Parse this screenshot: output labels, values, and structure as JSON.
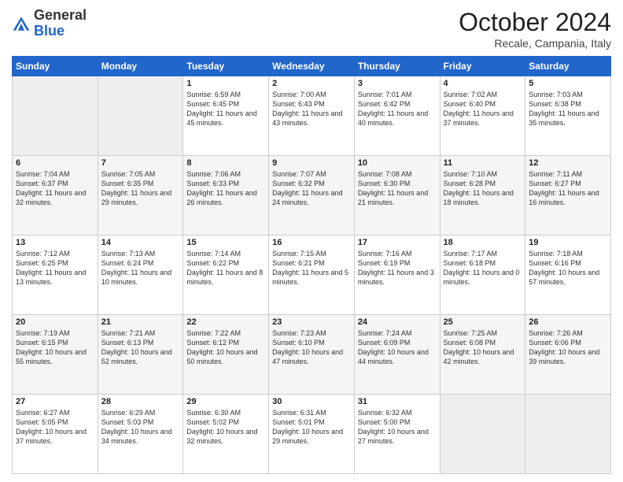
{
  "header": {
    "logo_general": "General",
    "logo_blue": "Blue",
    "month_title": "October 2024",
    "location": "Recale, Campania, Italy"
  },
  "days_of_week": [
    "Sunday",
    "Monday",
    "Tuesday",
    "Wednesday",
    "Thursday",
    "Friday",
    "Saturday"
  ],
  "weeks": [
    [
      {
        "day": "",
        "sunrise": "",
        "sunset": "",
        "daylight": ""
      },
      {
        "day": "",
        "sunrise": "",
        "sunset": "",
        "daylight": ""
      },
      {
        "day": "1",
        "sunrise": "Sunrise: 6:59 AM",
        "sunset": "Sunset: 6:45 PM",
        "daylight": "Daylight: 11 hours and 45 minutes."
      },
      {
        "day": "2",
        "sunrise": "Sunrise: 7:00 AM",
        "sunset": "Sunset: 6:43 PM",
        "daylight": "Daylight: 11 hours and 43 minutes."
      },
      {
        "day": "3",
        "sunrise": "Sunrise: 7:01 AM",
        "sunset": "Sunset: 6:42 PM",
        "daylight": "Daylight: 11 hours and 40 minutes."
      },
      {
        "day": "4",
        "sunrise": "Sunrise: 7:02 AM",
        "sunset": "Sunset: 6:40 PM",
        "daylight": "Daylight: 11 hours and 37 minutes."
      },
      {
        "day": "5",
        "sunrise": "Sunrise: 7:03 AM",
        "sunset": "Sunset: 6:38 PM",
        "daylight": "Daylight: 11 hours and 35 minutes."
      }
    ],
    [
      {
        "day": "6",
        "sunrise": "Sunrise: 7:04 AM",
        "sunset": "Sunset: 6:37 PM",
        "daylight": "Daylight: 11 hours and 32 minutes."
      },
      {
        "day": "7",
        "sunrise": "Sunrise: 7:05 AM",
        "sunset": "Sunset: 6:35 PM",
        "daylight": "Daylight: 11 hours and 29 minutes."
      },
      {
        "day": "8",
        "sunrise": "Sunrise: 7:06 AM",
        "sunset": "Sunset: 6:33 PM",
        "daylight": "Daylight: 11 hours and 26 minutes."
      },
      {
        "day": "9",
        "sunrise": "Sunrise: 7:07 AM",
        "sunset": "Sunset: 6:32 PM",
        "daylight": "Daylight: 11 hours and 24 minutes."
      },
      {
        "day": "10",
        "sunrise": "Sunrise: 7:08 AM",
        "sunset": "Sunset: 6:30 PM",
        "daylight": "Daylight: 11 hours and 21 minutes."
      },
      {
        "day": "11",
        "sunrise": "Sunrise: 7:10 AM",
        "sunset": "Sunset: 6:28 PM",
        "daylight": "Daylight: 11 hours and 18 minutes."
      },
      {
        "day": "12",
        "sunrise": "Sunrise: 7:11 AM",
        "sunset": "Sunset: 6:27 PM",
        "daylight": "Daylight: 11 hours and 16 minutes."
      }
    ],
    [
      {
        "day": "13",
        "sunrise": "Sunrise: 7:12 AM",
        "sunset": "Sunset: 6:25 PM",
        "daylight": "Daylight: 11 hours and 13 minutes."
      },
      {
        "day": "14",
        "sunrise": "Sunrise: 7:13 AM",
        "sunset": "Sunset: 6:24 PM",
        "daylight": "Daylight: 11 hours and 10 minutes."
      },
      {
        "day": "15",
        "sunrise": "Sunrise: 7:14 AM",
        "sunset": "Sunset: 6:22 PM",
        "daylight": "Daylight: 11 hours and 8 minutes."
      },
      {
        "day": "16",
        "sunrise": "Sunrise: 7:15 AM",
        "sunset": "Sunset: 6:21 PM",
        "daylight": "Daylight: 11 hours and 5 minutes."
      },
      {
        "day": "17",
        "sunrise": "Sunrise: 7:16 AM",
        "sunset": "Sunset: 6:19 PM",
        "daylight": "Daylight: 11 hours and 3 minutes."
      },
      {
        "day": "18",
        "sunrise": "Sunrise: 7:17 AM",
        "sunset": "Sunset: 6:18 PM",
        "daylight": "Daylight: 11 hours and 0 minutes."
      },
      {
        "day": "19",
        "sunrise": "Sunrise: 7:18 AM",
        "sunset": "Sunset: 6:16 PM",
        "daylight": "Daylight: 10 hours and 57 minutes."
      }
    ],
    [
      {
        "day": "20",
        "sunrise": "Sunrise: 7:19 AM",
        "sunset": "Sunset: 6:15 PM",
        "daylight": "Daylight: 10 hours and 55 minutes."
      },
      {
        "day": "21",
        "sunrise": "Sunrise: 7:21 AM",
        "sunset": "Sunset: 6:13 PM",
        "daylight": "Daylight: 10 hours and 52 minutes."
      },
      {
        "day": "22",
        "sunrise": "Sunrise: 7:22 AM",
        "sunset": "Sunset: 6:12 PM",
        "daylight": "Daylight: 10 hours and 50 minutes."
      },
      {
        "day": "23",
        "sunrise": "Sunrise: 7:23 AM",
        "sunset": "Sunset: 6:10 PM",
        "daylight": "Daylight: 10 hours and 47 minutes."
      },
      {
        "day": "24",
        "sunrise": "Sunrise: 7:24 AM",
        "sunset": "Sunset: 6:09 PM",
        "daylight": "Daylight: 10 hours and 44 minutes."
      },
      {
        "day": "25",
        "sunrise": "Sunrise: 7:25 AM",
        "sunset": "Sunset: 6:08 PM",
        "daylight": "Daylight: 10 hours and 42 minutes."
      },
      {
        "day": "26",
        "sunrise": "Sunrise: 7:26 AM",
        "sunset": "Sunset: 6:06 PM",
        "daylight": "Daylight: 10 hours and 39 minutes."
      }
    ],
    [
      {
        "day": "27",
        "sunrise": "Sunrise: 6:27 AM",
        "sunset": "Sunset: 5:05 PM",
        "daylight": "Daylight: 10 hours and 37 minutes."
      },
      {
        "day": "28",
        "sunrise": "Sunrise: 6:29 AM",
        "sunset": "Sunset: 5:03 PM",
        "daylight": "Daylight: 10 hours and 34 minutes."
      },
      {
        "day": "29",
        "sunrise": "Sunrise: 6:30 AM",
        "sunset": "Sunset: 5:02 PM",
        "daylight": "Daylight: 10 hours and 32 minutes."
      },
      {
        "day": "30",
        "sunrise": "Sunrise: 6:31 AM",
        "sunset": "Sunset: 5:01 PM",
        "daylight": "Daylight: 10 hours and 29 minutes."
      },
      {
        "day": "31",
        "sunrise": "Sunrise: 6:32 AM",
        "sunset": "Sunset: 5:00 PM",
        "daylight": "Daylight: 10 hours and 27 minutes."
      },
      {
        "day": "",
        "sunrise": "",
        "sunset": "",
        "daylight": ""
      },
      {
        "day": "",
        "sunrise": "",
        "sunset": "",
        "daylight": ""
      }
    ]
  ]
}
